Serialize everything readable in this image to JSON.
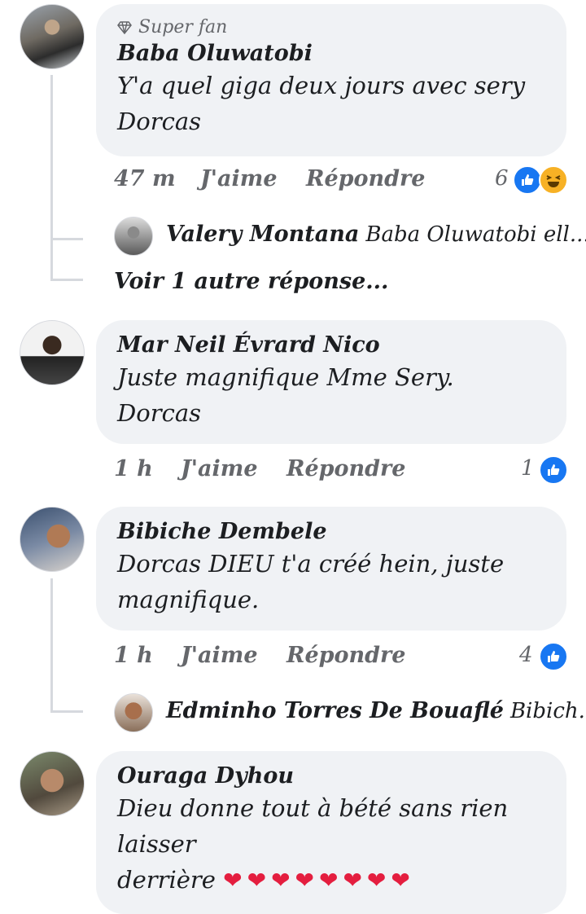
{
  "comments": [
    {
      "badge": "Super fan",
      "author": "Baba Oluwatobi",
      "text_lines": [
        "Y'a quel giga deux jours avec sery",
        "Dorcas"
      ],
      "time": "47 m",
      "like_label": "J'aime",
      "reply_label": "Répondre",
      "reaction_count": "6",
      "reactions": [
        "like-icon",
        "haha-icon"
      ]
    },
    {
      "author": "Mar Neil Évrard Nico",
      "text_lines": [
        "Juste magnifique Mme Sery.",
        "Dorcas"
      ],
      "time": "1 h",
      "like_label": "J'aime",
      "reply_label": "Répondre",
      "reaction_count": "1",
      "reactions": [
        "like-icon"
      ]
    },
    {
      "author": "Bibiche Dembele",
      "text_lines": [
        "Dorcas DIEU t'a créé hein, juste",
        "magnifique."
      ],
      "time": "1 h",
      "like_label": "J'aime",
      "reply_label": "Répondre",
      "reaction_count": "4",
      "reactions": [
        "like-icon"
      ]
    },
    {
      "author": "Ouraga Dyhou",
      "text_lines": [
        "Dieu donne tout à bété sans rien",
        "laisser",
        "derrière"
      ],
      "hearts": "❤❤❤❤❤❤❤❤"
    }
  ],
  "replies": [
    {
      "author": "Valery Montana",
      "preview": "Baba Oluwatobi ell..."
    },
    {
      "author": "Edminho Torres De Bouaflé",
      "preview": "Bibich..."
    }
  ],
  "more_replies": "Voir 1 autre réponse...",
  "colors": {
    "bubble": "#f0f2f5",
    "like": "#1877f2",
    "haha": "#f7b125",
    "heart": "#e41e3f"
  }
}
